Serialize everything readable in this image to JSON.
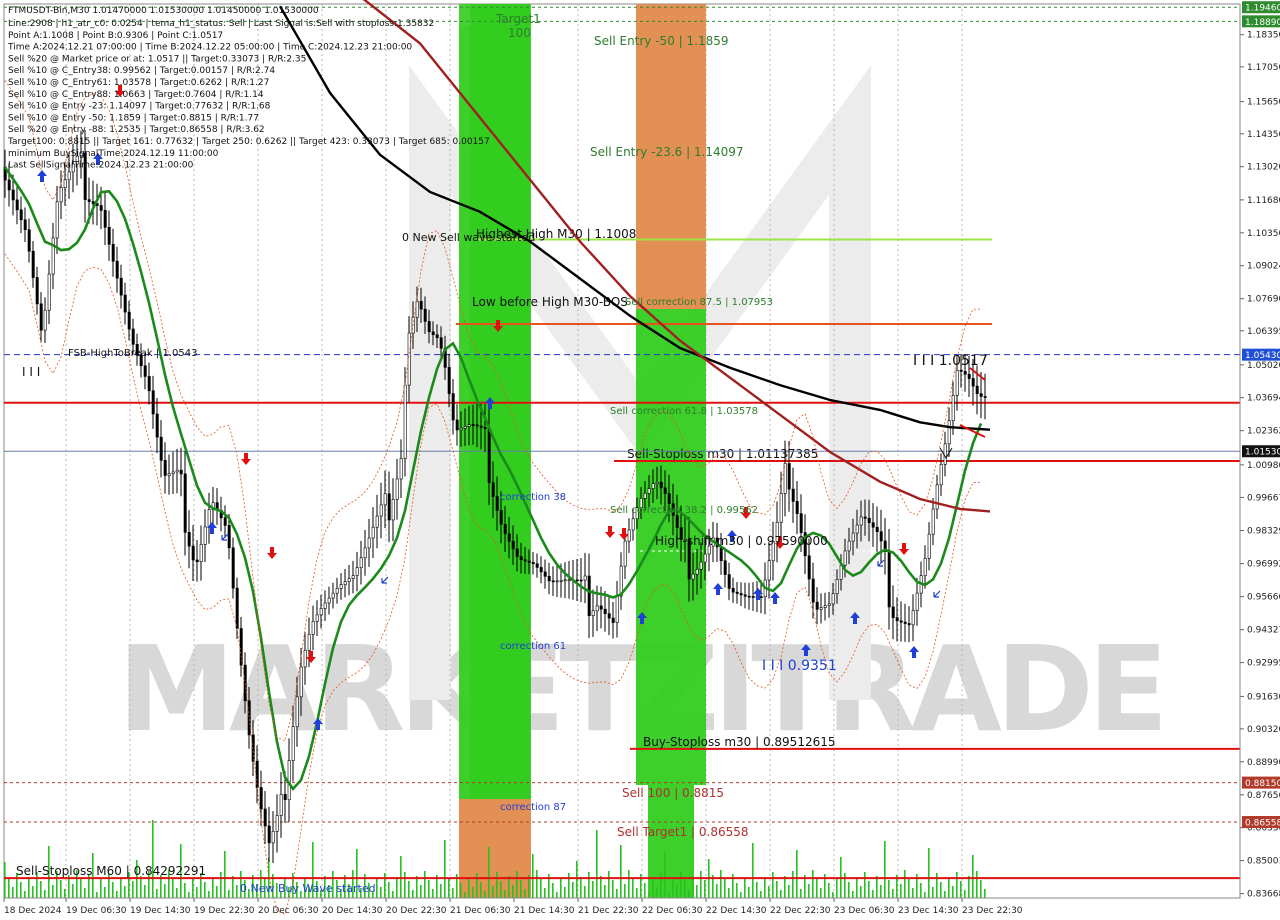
{
  "chart_data": {
    "type": "candlestick",
    "symbol_header": "FTMUSDT-Bin,M30  1.01470000 1.01530000 1.01450000 1.01530000",
    "info_lines": [
      "Line:2908 | h1_atr_c0: 0.0254 | tema_h1_status: Sell | Last Signal is:Sell with stoploss:1.35832",
      "Point A:1.1008 | Point B:0.9306 | Point C:1.0517",
      "Time A:2024.12.21 07:00:00 | Time B:2024.12.22 05:00:00 | Time C:2024.12.23 21:00:00",
      "Sell %20 @ Market price or at: 1.0517 || Target:0.33073 | R/R:2.35",
      "Sell %10 @ C_Entry38: 0.99562 | Target:0.00157 | R/R:2.74",
      "Sell %10 @ C_Entry61: 1.03578 | Target:0.6262 | R/R:1.27",
      "Sell %10 @ C_Entry88: 1.0663 | Target:0.7604 | R/R:1.14",
      "Sell %10 @ Entry -23: 1.14097 | Target:0.77632 | R/R:1.68",
      "Sell %10 @ Entry -50: 1.1859 | Target:0.8815 | R/R:1.77",
      "Sell %20 @ Entry -88: 1.2535 | Target:0.86558 | R/R:3.62",
      "Target100: 0.8815 || Target 161: 0.77632 | Target 250: 0.6262 || Target 423: 0.33073 | Target 685: 0.00157",
      "minimum BuySignalTime:2024.12.19 11:00:00",
      "Last SellSignalTime:2024.12.23 21:00:00"
    ],
    "x_ticks": [
      "18 Dec 2024",
      "19 Dec 06:30",
      "19 Dec 14:30",
      "19 Dec 22:30",
      "20 Dec 06:30",
      "20 Dec 14:30",
      "20 Dec 22:30",
      "21 Dec 06:30",
      "21 Dec 14:30",
      "21 Dec 22:30",
      "22 Dec 06:30",
      "22 Dec 14:30",
      "22 Dec 22:30",
      "23 Dec 06:30",
      "23 Dec 14:30",
      "23 Dec 22:30"
    ],
    "y_ticks": [
      1.1835,
      1.1705,
      1.1565,
      1.1435,
      1.1302,
      1.1168,
      1.1035,
      1.09024,
      1.0769,
      1.06395,
      1.0502,
      1.03694,
      1.02362,
      1.0098,
      0.99667,
      0.98329,
      0.96992,
      0.9566,
      0.94327,
      0.92995,
      0.9163,
      0.9032,
      0.8899,
      0.87656,
      0.8633,
      0.85001,
      0.83668
    ],
    "ylim": [
      0.8349,
      1.1959
    ],
    "current_price_badge": "1.01530",
    "right_badges": [
      {
        "value": "1.19460",
        "color": "#2e8b2e"
      },
      {
        "value": "1.18890",
        "color": "#2e8b2e"
      },
      {
        "value": "1.05430",
        "color": "#1f4fd6"
      },
      {
        "value": "1.01530",
        "color": "#111111"
      },
      {
        "value": "0.88150",
        "color": "#b23a2a"
      },
      {
        "value": "0.86558",
        "color": "#b23a2a"
      }
    ],
    "levels": [
      {
        "label": "Highest High   M30 | 1.1008",
        "price": 1.1008,
        "color": "#9de34a"
      },
      {
        "label": "Low before High   M30-BOS",
        "price": 1.0667,
        "color": "#e8531b"
      },
      {
        "label": "FSB-HighToBreak | 1.0543",
        "price": 1.0543,
        "color": "#2233cc"
      },
      {
        "label": "",
        "price": 1.0349,
        "color": "#e01010"
      },
      {
        "label": "Sell-Stoploss m30 | 1.01137385",
        "price": 1.01137,
        "color": "#e01010"
      },
      {
        "label": "Buy-Stoploss m30 | 0.89512615",
        "price": 0.89513,
        "color": "#e01010"
      },
      {
        "label": "Sell-Stoploss M60 | 0.84292291",
        "price": 0.84292,
        "color": "#e01010"
      }
    ],
    "annotations": [
      {
        "text": "Sell Entry -50 | 1.1859",
        "color": "#2e7d2e"
      },
      {
        "text": "Sell Entry -23.6 | 1.14097",
        "color": "#2e7d2e"
      },
      {
        "text": "Sell correction 87.5 | 1.07953",
        "color": "#2e7d2e"
      },
      {
        "text": "Sell correction 61.8 | 1.03578",
        "color": "#2e7d2e"
      },
      {
        "text": "Sell correction 38.2 | 0.99562",
        "color": "#2e7d2e"
      },
      {
        "text": "Sell 100 | 0.8815",
        "color": "#b03030"
      },
      {
        "text": "Sell Target1 | 0.86558",
        "color": "#b03030"
      },
      {
        "text": "High-shift m30 | 0.97590000",
        "color": "#111111"
      },
      {
        "text": "0 New Sell wave started",
        "color": "#111111"
      },
      {
        "text": "0 New Buy Wave started",
        "color": "#1f3fd6"
      },
      {
        "text": "I I I 1.0517",
        "color": "#111111"
      },
      {
        "text": "I I I 0.9351",
        "color": "#1f3fd6"
      },
      {
        "text": "correction 38",
        "color": "#1f3fd6"
      },
      {
        "text": "correction 61",
        "color": "#1f3fd6"
      },
      {
        "text": "correction 87",
        "color": "#1f3fd6"
      },
      {
        "text": "Target1",
        "color": "#2e7d2e"
      },
      {
        "text": "100",
        "color": "#2e7d2e"
      },
      {
        "text": "I I I",
        "color": "#111111"
      }
    ],
    "watermark": "MARKETZITRADE",
    "colors": {
      "zone_green": "#33cc1f",
      "zone_orange": "#e08a4a",
      "ma_green": "#1a8a1a",
      "ma_black": "#000000",
      "ma_darkred": "#a02020",
      "candle": "#000000",
      "volume": "#27c21f"
    }
  }
}
